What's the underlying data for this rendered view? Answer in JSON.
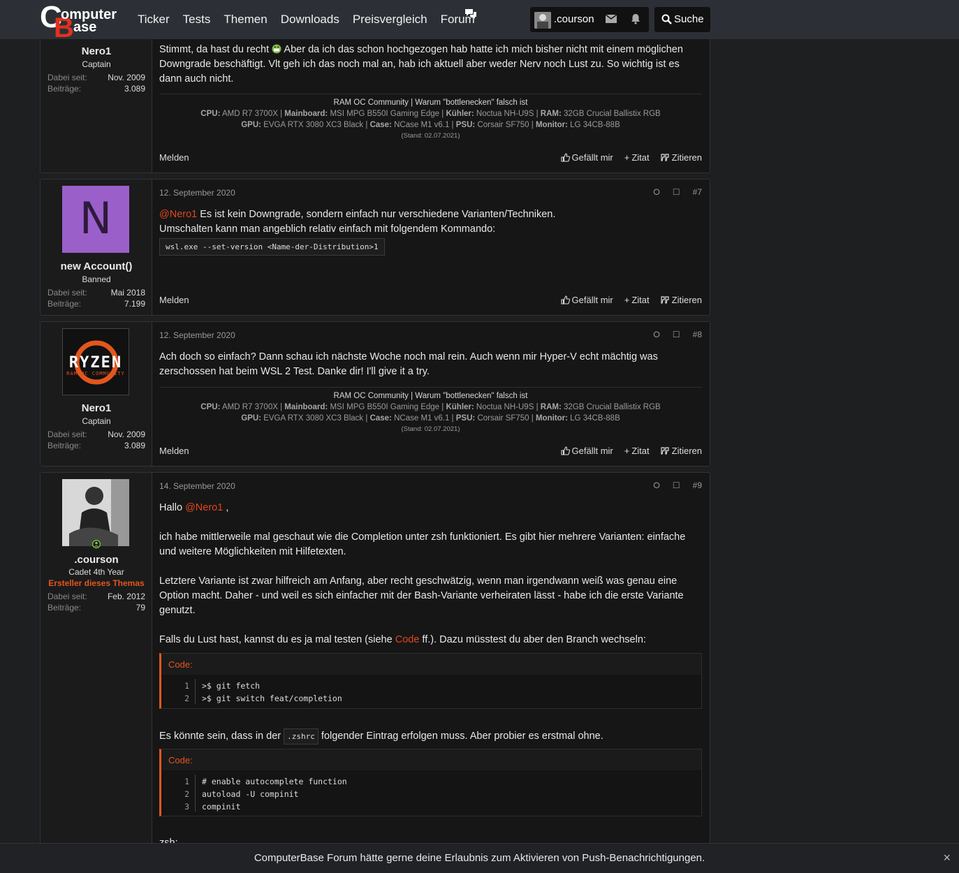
{
  "header": {
    "logo_top": "omputer",
    "logo_bottom": "ase",
    "nav": [
      "Ticker",
      "Tests",
      "Themen",
      "Downloads",
      "Preisvergleich",
      "Forum"
    ],
    "username": ".courson",
    "search_label": "Suche"
  },
  "common": {
    "report": "Melden",
    "like": "Gefällt mir",
    "quote_plus": "Zitat",
    "quote": "Zitieren",
    "joined_label": "Dabei seit:",
    "posts_label": "Beiträge:"
  },
  "signature": {
    "line1_a": "RAM OC Community",
    "line1_b": "Warum \"bottlenecken\" falsch ist",
    "cpu_k": "CPU:",
    "cpu_v": "AMD R7 3700X",
    "mb_k": "Mainboard:",
    "mb_v": "MSI MPG B550I Gaming Edge",
    "cool_k": "Kühler:",
    "cool_v": "Noctua NH-U9S",
    "ram_k": "RAM:",
    "ram_v": "32GB Crucial Ballistix RGB",
    "gpu_k": "GPU:",
    "gpu_v": "EVGA RTX 3080 XC3 Black",
    "case_k": "Case:",
    "case_v": "NCase M1 v6.1",
    "psu_k": "PSU:",
    "psu_v": "Corsair SF750",
    "mon_k": "Monitor:",
    "mon_v": "LG 34CB-88B",
    "stand": "(Stand: 02.07.2021)"
  },
  "posts": [
    {
      "user": "Nero1",
      "title": "Captain",
      "joined": "Nov. 2009",
      "count": "3.089",
      "text_a": "Stimmt, da hast du recht",
      "text_b": "Aber da ich das schon hochgezogen hab hatte ich mich bisher nicht mit einem möglichen Downgrade beschäftigt. Vlt geh ich das noch mal an, hab ich aktuell aber weder Nerv noch Lust zu. So wichtig ist es dann auch nicht."
    },
    {
      "user": "new Account()",
      "title": "Banned",
      "joined": "Mai 2018",
      "count": "7.199",
      "avatar_letter": "N",
      "date": "12. September 2020",
      "num": "#7",
      "mention": "@Nero1",
      "text_a": "Es ist kein Downgrade, sondern einfach nur verschiedene Varianten/Techniken.",
      "text_b": "Umschalten kann man angeblich relativ einfach mit folgendem Kommando:",
      "code": "wsl.exe --set-version <Name-der-Distribution>1"
    },
    {
      "user": "Nero1",
      "title": "Captain",
      "joined": "Nov. 2009",
      "count": "3.089",
      "avatar_text": "RYZEN",
      "avatar_sub": "RAM OC COMMUNITY",
      "date": "12. September 2020",
      "num": "#8",
      "text": "Ach doch so einfach? Dann schau ich nächste Woche noch mal rein. Auch wenn mir Hyper-V echt mächtig was zerschossen hat beim WSL 2 Test. Danke dir! I'll give it a try."
    },
    {
      "user": ".courson",
      "title": "Cadet 4th Year",
      "starter": "Ersteller dieses Themas",
      "joined": "Feb. 2012",
      "count": "79",
      "date": "14. September 2020",
      "num": "#9",
      "hello": "Hallo",
      "mention": "@Nero1",
      "comma": ",",
      "p1": "ich habe mittlerweile mal geschaut wie die Completion unter zsh funktioniert. Es gibt hier mehrere Varianten: einfache und weitere Möglichkeiten mit Hilfetexten.",
      "p2": "Letztere Variante ist zwar hilfreich am Anfang, aber recht geschwätzig, wenn man irgendwann weiß was genau eine Option macht. Daher - und weil es sich einfacher mit der Bash-Variante verheiraten lässt - habe ich die erste Variante genutzt.",
      "p3_a": "Falls du Lust hast, kannst du es ja mal testen (siehe",
      "p3_link": "Code",
      "p3_b": "ff.). Dazu müsstest du aber den Branch wechseln:",
      "code_label": "Code:",
      "code1": [
        "1",
        "2"
      ],
      "code1_lines": [
        ">$ git fetch",
        ">$ git switch feat/completion"
      ],
      "p4_a": "Es könnte sein, dass in der",
      "p4_code": ".zshrc",
      "p4_b": "folgender Eintrag erfolgen muss. Aber probier es erstmal ohne.",
      "code2": [
        "1",
        "2",
        "3"
      ],
      "code2_lines": [
        "# enable autocomplete function",
        "autoload -U compinit",
        "compinit"
      ],
      "trail": "zsh:"
    }
  ],
  "banner": {
    "message": "ComputerBase Forum hätte gerne deine Erlaubnis zum Aktivieren von Push-Benachrichtigungen.",
    "close": "×"
  }
}
